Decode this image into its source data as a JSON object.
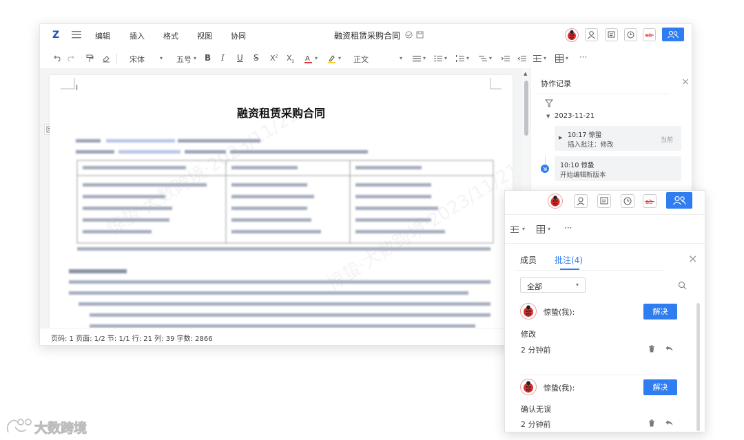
{
  "menubar": {
    "items": [
      "编辑",
      "插入",
      "格式",
      "视图",
      "协同"
    ],
    "doc_title": "融资租赁采购合同"
  },
  "toolbar": {
    "font": "宋体",
    "size": "五号",
    "style": "正文",
    "more": "···"
  },
  "document": {
    "heading": "融资租赁采购合同",
    "watermark_text": "惊蛰·大数跨境·2023/11/21"
  },
  "status": {
    "text": "页码: 1  页面: 1/2    节: 1/1  行: 21  列: 39  字数: 2866"
  },
  "history": {
    "title": "协作记录",
    "date": "2023-11-21",
    "entries": [
      {
        "time_user": "10:17 惊蛰",
        "action": "插入批注：修改",
        "tag": "当前"
      },
      {
        "time_user": "10:10 惊蛰",
        "action": "开始编辑新版本",
        "tag": ""
      }
    ]
  },
  "comments_panel": {
    "more": "···",
    "tabs": [
      "成员",
      "批注(4)"
    ],
    "filter": "全部",
    "comments": [
      {
        "author": "惊蛰(我):",
        "resolve": "解决",
        "body": "修改",
        "time": "2 分钟前"
      },
      {
        "author": "惊蛰(我):",
        "resolve": "解决",
        "body": "确认无误",
        "time": "2 分钟前"
      }
    ]
  },
  "brand": {
    "logo_text": "大数跨境"
  },
  "colors": {
    "accent": "#2f7df0",
    "ladybug": "#d8302f",
    "strike_icon": "#d33"
  }
}
